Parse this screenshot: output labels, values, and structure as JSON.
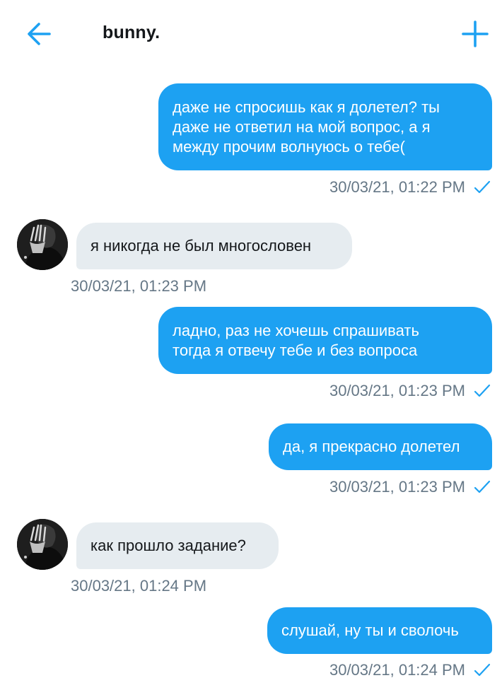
{
  "header": {
    "title": "bunny.",
    "back_icon": "arrow-left-icon",
    "add_icon": "plus-icon",
    "accent": "#1da1f2"
  },
  "messages": [
    {
      "direction": "outgoing",
      "lines": [
        "даже не спросишь как я долетел? ты",
        "даже не ответил на мой вопрос, а я",
        "между прочим волнуюсь о тебе("
      ],
      "timestamp": "30/03/21, 01:22 PM",
      "read": true
    },
    {
      "direction": "incoming",
      "lines": [
        "я никогда не был многословен"
      ],
      "timestamp": "30/03/21, 01:23 PM"
    },
    {
      "direction": "outgoing",
      "lines": [
        "ладно, раз не хочешь спрашивать",
        "тогда я отвечу тебе и без вопроса"
      ],
      "timestamp": "30/03/21, 01:23 PM",
      "read": true
    },
    {
      "direction": "outgoing",
      "lines": [
        "да, я прекрасно долетел"
      ],
      "timestamp": "30/03/21, 01:23 PM",
      "read": true
    },
    {
      "direction": "incoming",
      "lines": [
        "как прошло задание?"
      ],
      "timestamp": "30/03/21, 01:24 PM"
    },
    {
      "direction": "outgoing",
      "lines": [
        "слушай, ну ты и сволочь"
      ],
      "timestamp": "30/03/21, 01:24 PM",
      "read": true
    }
  ],
  "colors": {
    "outgoing_bubble": "#1da1f2",
    "incoming_bubble": "#e6ecf0",
    "timestamp": "#657786"
  }
}
